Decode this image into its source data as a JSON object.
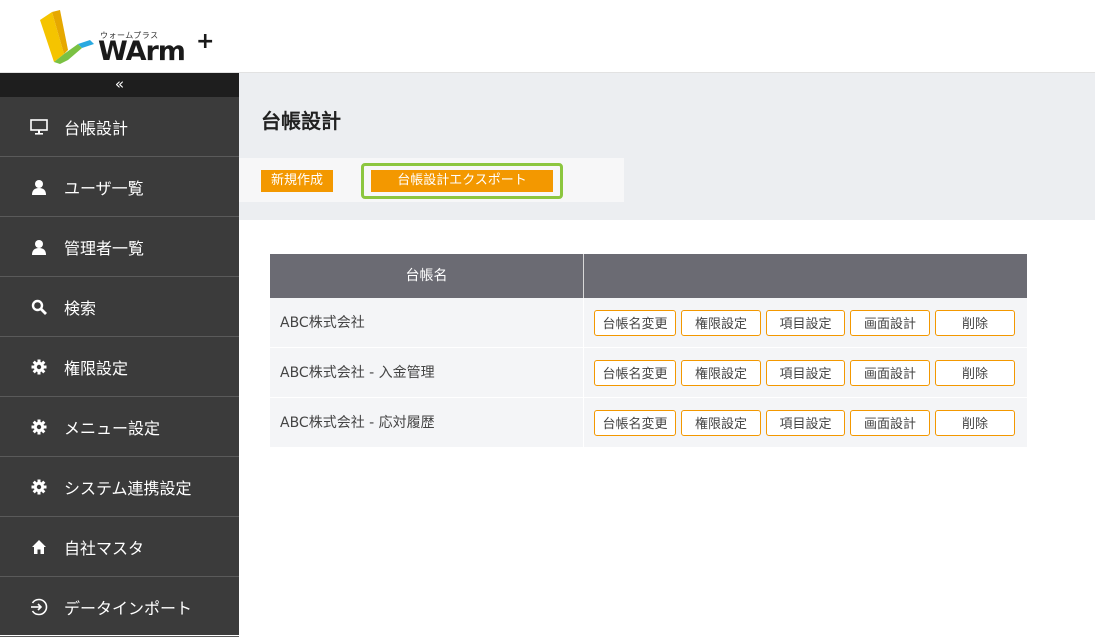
{
  "header": {
    "logo_ruby": "ウォームプラス",
    "logo_text": "WArm",
    "logo_plus": "+"
  },
  "sidebar": {
    "collapse_label": "«",
    "items": [
      {
        "label": "台帳設計",
        "icon": "monitor-icon"
      },
      {
        "label": "ユーザ一覧",
        "icon": "user-icon"
      },
      {
        "label": "管理者一覧",
        "icon": "user-icon"
      },
      {
        "label": "検索",
        "icon": "search-icon"
      },
      {
        "label": "権限設定",
        "icon": "gear-icon"
      },
      {
        "label": "メニュー設定",
        "icon": "gear-icon"
      },
      {
        "label": "システム連携設定",
        "icon": "gear-icon"
      },
      {
        "label": "自社マスタ",
        "icon": "home-icon"
      },
      {
        "label": "データインポート",
        "icon": "import-icon"
      }
    ]
  },
  "main": {
    "title": "台帳設計",
    "toolbar": {
      "new_label": "新規作成",
      "export_label": "台帳設計エクスポート"
    },
    "table": {
      "header_name": "台帳名",
      "actions": [
        "台帳名変更",
        "権限設定",
        "項目設定",
        "画面設計",
        "削除"
      ],
      "rows": [
        {
          "name": "ABC株式会社"
        },
        {
          "name": "ABC株式会社 - 入金管理"
        },
        {
          "name": "ABC株式会社 - 応対履歴"
        }
      ]
    }
  },
  "colors": {
    "accent": "#f39800",
    "highlight": "#8cc63f",
    "sidebar_bg": "#3b3b3b",
    "table_header_bg": "#6b6b73"
  }
}
